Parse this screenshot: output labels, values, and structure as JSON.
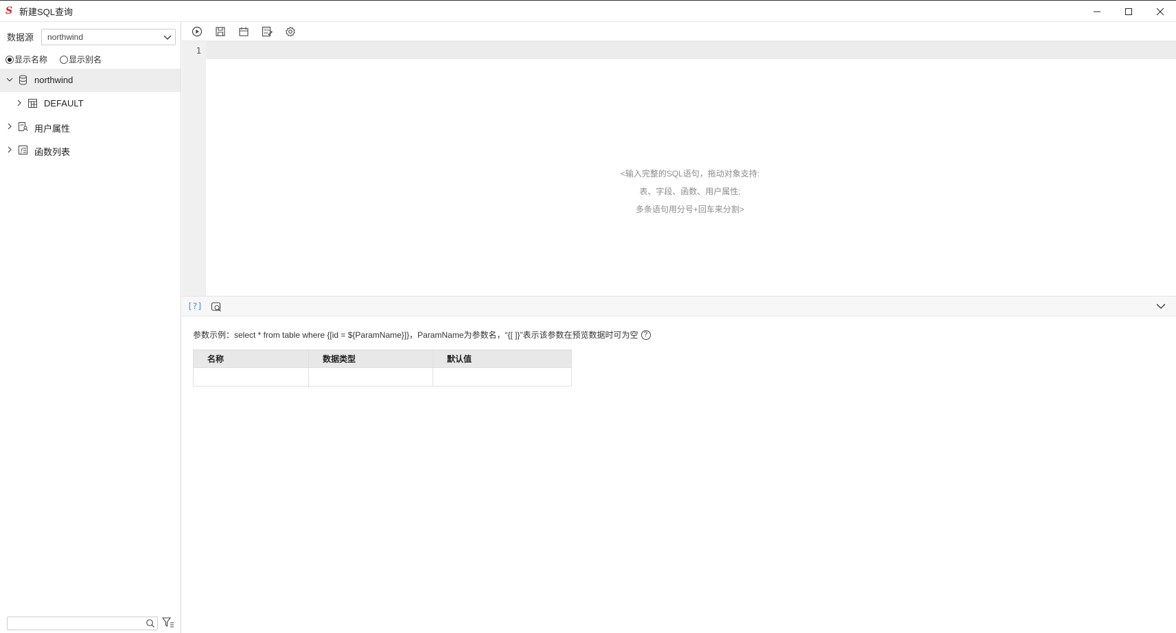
{
  "window": {
    "title": "新建SQL查询",
    "logo": "S",
    "controls": [
      "minimize-icon",
      "maximize-icon",
      "close-icon"
    ]
  },
  "sidebar": {
    "datasource_label": "数据源",
    "datasource_value": "northwind",
    "radio_show_name": "显示名称",
    "radio_show_alias": "显示别名",
    "selected_radio": "显示名称",
    "tree": [
      {
        "label": "northwind",
        "icon": "database-icon",
        "expanded": true,
        "level": 0
      },
      {
        "label": "DEFAULT",
        "icon": "schema-table-icon",
        "expanded": false,
        "level": 1
      },
      {
        "label": "用户属性",
        "icon": "user-attribute-icon",
        "expanded": false,
        "level": 0
      },
      {
        "label": "函数列表",
        "icon": "function-list-icon",
        "expanded": false,
        "level": 0
      }
    ],
    "search_placeholder": ""
  },
  "toolbar": {
    "buttons": [
      "run-icon",
      "save-icon",
      "calendar-icon",
      "sql-format-icon",
      "settings-icon"
    ]
  },
  "editor": {
    "line_number": "1",
    "placeholder_lines": [
      "<输入完整的SQL语句，拖动对象支持:",
      "表、字段、函数、用户属性;",
      "多条语句用分号+回车来分割>"
    ]
  },
  "param_bar": {
    "help_label": "[?]"
  },
  "params": {
    "hint": "参数示例：select * from table where {[id = ${ParamName}]}，ParamName为参数名，“{[ ]}”表示该参数在预览数据时可为空",
    "help_icon": "?",
    "columns": [
      "名称",
      "数据类型",
      "默认值"
    ],
    "rows": [
      [
        "",
        "",
        ""
      ]
    ]
  },
  "colors": {
    "accent": "#3a8ee6",
    "logo": "#e02020",
    "selected_row": "#ededed"
  }
}
